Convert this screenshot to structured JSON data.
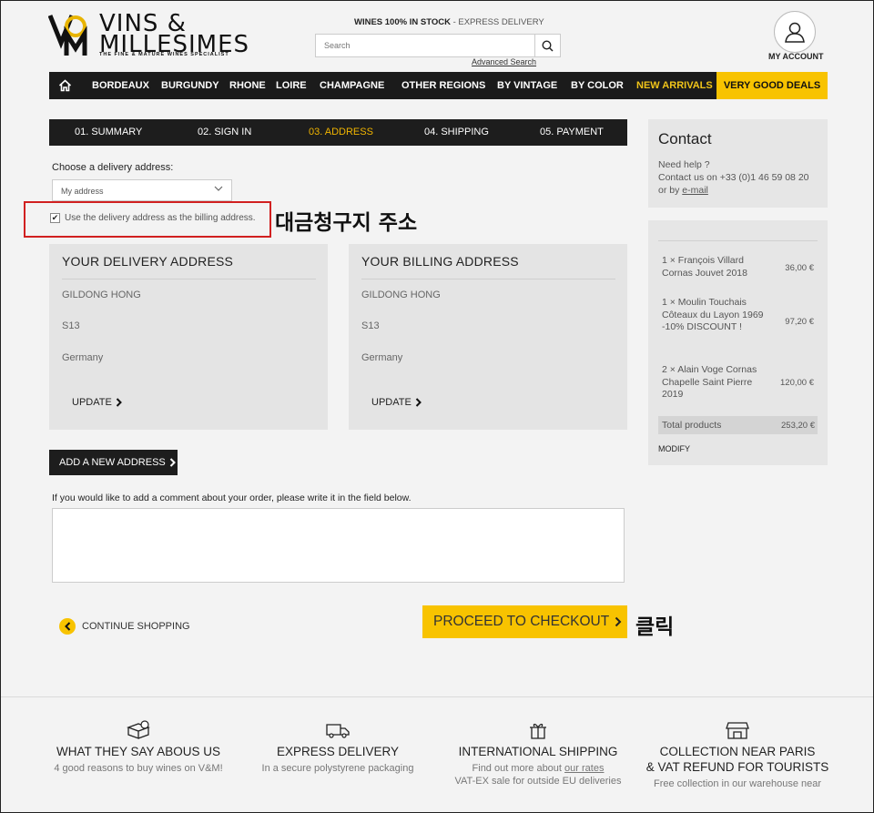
{
  "header": {
    "logo_name": "VINS & MILLESIMES",
    "logo_tagline": "THE FINE & MATURE WINES SPECIALIST",
    "stock_bold": "WINES 100% IN STOCK",
    "stock_rest": " - EXPRESS DELIVERY",
    "search_placeholder": "Search",
    "advanced_search": "Advanced Search",
    "account_label": "MY ACCOUNT"
  },
  "nav": {
    "items": [
      "BORDEAUX",
      "BURGUNDY",
      "RHONE",
      "LOIRE",
      "CHAMPAGNE",
      "OTHER REGIONS",
      "BY VINTAGE",
      "BY COLOR",
      "NEW ARRIVALS"
    ],
    "deals": "VERY GOOD DEALS"
  },
  "steps": [
    "01. SUMMARY",
    "02. SIGN IN",
    "03. ADDRESS",
    "04. SHIPPING",
    "05. PAYMENT"
  ],
  "address_form": {
    "choose_label": "Choose a delivery address:",
    "selected": "My address",
    "same_billing_label": "Use the delivery address as the billing address.",
    "same_billing_checked": true,
    "add_new": "ADD A NEW ADDRESS",
    "comment_label": "If you would like to add a comment about your order, please write it in the field below.",
    "comment_value": ""
  },
  "annotations": {
    "billing": "대금청구지 주소",
    "click": "클릭"
  },
  "delivery_card": {
    "title": "YOUR DELIVERY ADDRESS",
    "name": "GILDONG HONG",
    "line": "S13",
    "country": "Germany",
    "update": "UPDATE"
  },
  "billing_card": {
    "title": "YOUR BILLING ADDRESS",
    "name": "GILDONG HONG",
    "line": "S13",
    "country": "Germany",
    "update": "UPDATE"
  },
  "actions": {
    "continue": "CONTINUE SHOPPING",
    "checkout": "PROCEED TO CHECKOUT"
  },
  "contact": {
    "title": "Contact",
    "help": "Need help ?",
    "phone": "Contact us on +33 (0)1 46 59 08 20",
    "email_prefix": "or by ",
    "email_link": "e-mail"
  },
  "cart": {
    "items": [
      {
        "desc": "1 × François Villard Cornas Jouvet 2018",
        "price": "36,00 €"
      },
      {
        "desc": "1 × Moulin Touchais Côteaux du Layon 1969 -10% DISCOUNT !",
        "price": "97,20 €"
      },
      {
        "desc": "2 × Alain Voge Cornas Chapelle Saint Pierre 2019",
        "price": "120,00 €"
      }
    ],
    "total_label": "Total products",
    "total_value": "253,20 €",
    "modify": "MODIFY"
  },
  "footer": {
    "features": [
      {
        "icon": "box-icon",
        "title": "WHAT THEY SAY ABOUS US",
        "sub": "4 good reasons to buy wines on V&M!"
      },
      {
        "icon": "truck-icon",
        "title": "EXPRESS DELIVERY",
        "sub": "In a secure polystyrene packaging"
      },
      {
        "icon": "gift-icon",
        "title": "INTERNATIONAL SHIPPING",
        "sub_prefix": "Find out more about ",
        "sub_link": "our rates",
        "sub2": "VAT-EX sale for outside EU deliveries"
      },
      {
        "icon": "store-icon",
        "title": "COLLECTION NEAR PARIS",
        "title2": "& VAT REFUND FOR TOURISTS",
        "sub": "Free collection in our warehouse near"
      }
    ]
  },
  "colors": {
    "accent": "#f8c300",
    "dark": "#1b1b1b",
    "annotation_box": "#d12020"
  }
}
